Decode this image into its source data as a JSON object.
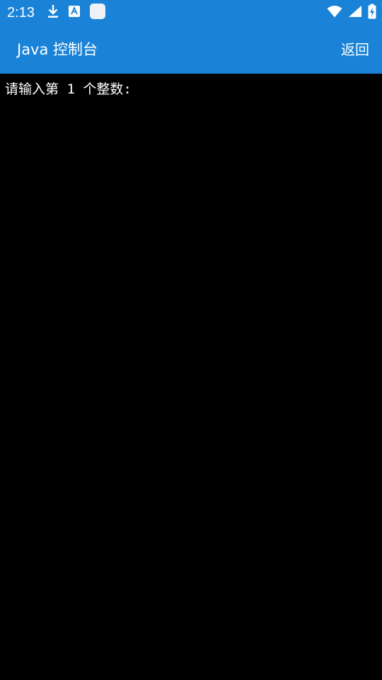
{
  "status_bar": {
    "time": "2:13",
    "left_icons": [
      "download-icon",
      "accessibility-app-icon",
      "app-square-icon"
    ],
    "right_icons": [
      "wifi-icon",
      "cellular-signal-icon",
      "battery-charging-icon"
    ]
  },
  "app_bar": {
    "title": "Java 控制台",
    "back_label": "返回"
  },
  "console": {
    "lines": [
      "请输入第 1 个整数:"
    ]
  },
  "colors": {
    "accent": "#1a83d8",
    "console_bg": "#000000",
    "text": "#ffffff"
  }
}
